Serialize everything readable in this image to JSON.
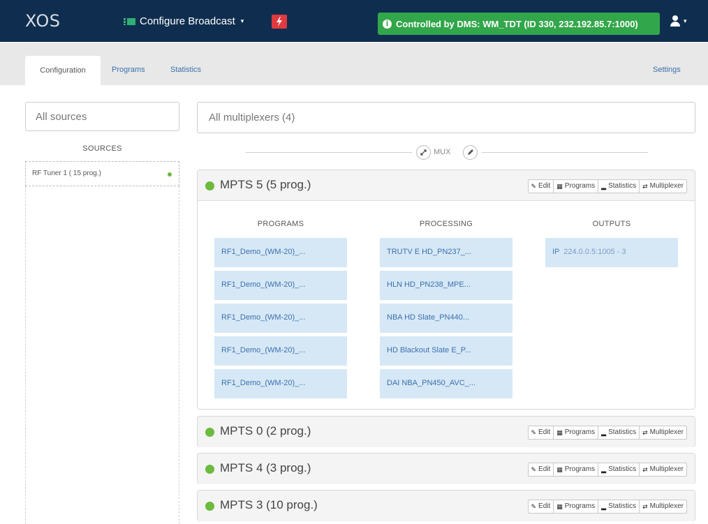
{
  "navbar": {
    "logo": "XOS",
    "config_label": "Configure Broadcast",
    "config_caret": "▾",
    "flash_icon": "flash-icon",
    "dms_badge": "Controlled by DMS: WM_TDT (ID 330, 232.192.85.7:1000)",
    "user_caret": "▾"
  },
  "tabs": {
    "configuration": "Configuration",
    "programs": "Programs",
    "statistics": "Statistics",
    "settings": "Settings"
  },
  "sources": {
    "placeholder": "All sources",
    "title": "SOURCES",
    "items": [
      {
        "label": "RF Tuner 1 ( 15 prog.)",
        "status_color": "#6cba3e"
      }
    ]
  },
  "multiplexers": {
    "placeholder": "All multiplexers (4)",
    "mux_label": "MUX",
    "panels": [
      {
        "title": "MPTS 5 (5 prog.)",
        "expanded": true,
        "status_color": "#6cba3e",
        "columns": {
          "programs": "PROGRAMS",
          "processing": "PROCESSING",
          "outputs": "OUTPUTS"
        },
        "programs": [
          "RF1_Demo_(WM-20)_...",
          "RF1_Demo_(WM-20)_...",
          "RF1_Demo_(WM-20)_...",
          "RF1_Demo_(WM-20)_...",
          "RF1_Demo_(WM-20)_..."
        ],
        "processing": [
          "TRUTV E HD_PN237_...",
          "HLN HD_PN238_MPE...",
          "NBA HD Slate_PN440...",
          "HD Blackout Slate E_P...",
          "DAI NBA_PN450_AVC_..."
        ],
        "outputs": [
          {
            "type": "IP",
            "address": "224.0.0.5:1005  - 3"
          }
        ]
      },
      {
        "title": "MPTS 0 (2 prog.)",
        "expanded": false,
        "status_color": "#6cba3e"
      },
      {
        "title": "MPTS 4 (3 prog.)",
        "expanded": false,
        "status_color": "#6cba3e"
      },
      {
        "title": "MPTS 3 (10 prog.)",
        "expanded": false,
        "status_color": "#6cba3e"
      }
    ],
    "panel_buttons": {
      "edit": "Edit",
      "programs": "Programs",
      "statistics": "Statistics",
      "multiplexer": "Multiplexer"
    }
  },
  "colors": {
    "navbar": "#0f2e4f",
    "dms_badge": "#32a64a",
    "flash_button": "#e0393e",
    "cell": "#d6e8f6",
    "link": "#3a6fae",
    "status_ok": "#6cba3e"
  }
}
